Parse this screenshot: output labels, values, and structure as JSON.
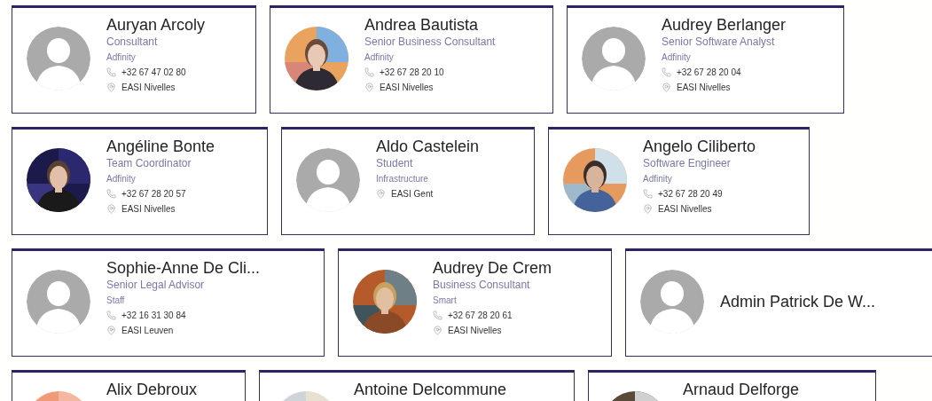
{
  "rows": [
    [
      {
        "name": "Auryan Arcoly",
        "title": "Consultant",
        "company": "Adfinity",
        "phone": "+32 67 47 02 80",
        "location": "EASI Nivelles",
        "kind": "placeholder"
      },
      {
        "name": "Andrea Bautista",
        "title": "Senior Business Consultant",
        "company": "Adfinity",
        "phone": "+32 67 28 20 10",
        "location": "EASI Nivelles"
      },
      {
        "name": "Audrey Berlanger",
        "title": "Senior Software Analyst",
        "company": "Adfinity",
        "phone": "+32 67 28 20 04",
        "location": "EASI Nivelles",
        "kind": "placeholder"
      }
    ],
    [
      {
        "name": "Angéline Bonte",
        "title": "Team Coordinator",
        "company": "Adfinity",
        "phone": "+32 67 28 20 57",
        "location": "EASI Nivelles"
      },
      {
        "name": "Aldo Castelein",
        "title": "Student",
        "company": "Infrastructure",
        "location": "EASI Gent",
        "kind": "placeholder"
      },
      {
        "name": "Angelo Ciliberto",
        "title": "Software Engineer",
        "company": "Adfinity",
        "phone": "+32 67 28 20 49",
        "location": "EASI Nivelles"
      }
    ],
    [
      {
        "name": "Sophie-Anne De Cli...",
        "title": "Senior Legal Advisor",
        "company": "Staff",
        "phone": "+32 16 31 30 84",
        "location": "EASI Leuven",
        "kind": "placeholder"
      },
      {
        "name": "Audrey De Crem",
        "title": "Business Consultant",
        "company": "Smart",
        "phone": "+32 67 28 20 61",
        "location": "EASI Nivelles"
      },
      {
        "name": "Admin Patrick De W...",
        "kind": "placeholder"
      }
    ],
    [
      {
        "name": "Alix Debroux"
      },
      {
        "name": "Antoine Delcommune"
      },
      {
        "name": "Arnaud Delforge"
      }
    ]
  ]
}
